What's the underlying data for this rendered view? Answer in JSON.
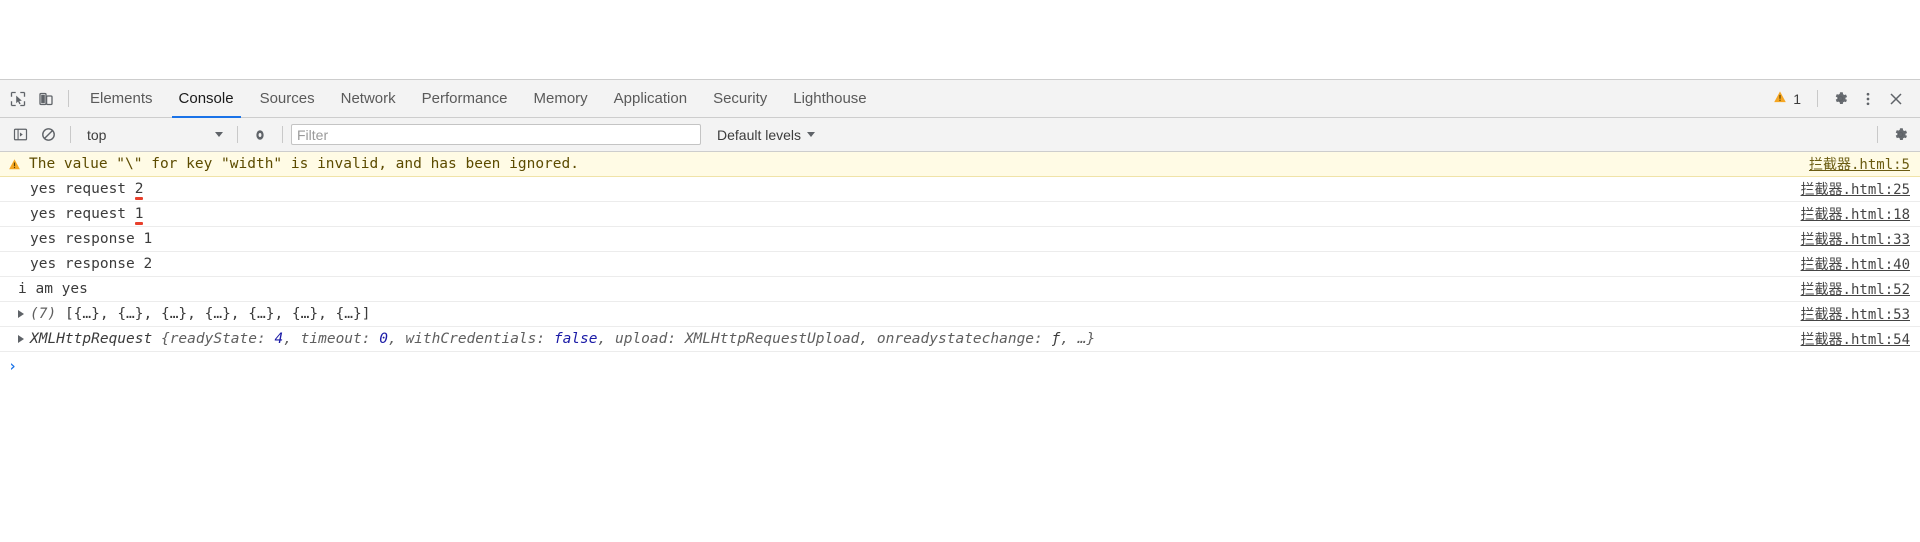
{
  "devtools": {
    "tabstrip": {
      "inspect_icon": "inspect-cursor-icon",
      "device_icon": "device-toolbar-icon",
      "tabs": [
        {
          "label": "Elements",
          "active": false
        },
        {
          "label": "Console",
          "active": true
        },
        {
          "label": "Sources",
          "active": false
        },
        {
          "label": "Network",
          "active": false
        },
        {
          "label": "Performance",
          "active": false
        },
        {
          "label": "Memory",
          "active": false
        },
        {
          "label": "Application",
          "active": false
        },
        {
          "label": "Security",
          "active": false
        },
        {
          "label": "Lighthouse",
          "active": false
        }
      ],
      "warning_count": "1",
      "warning_icon": "warning-triangle-icon",
      "settings_icon": "gear-icon",
      "more_icon": "kebab-menu-icon",
      "close_icon": "close-icon"
    },
    "filterbar": {
      "sidebar_icon": "console-sidebar-toggle-icon",
      "clear_icon": "clear-console-icon",
      "context": "top",
      "eye_icon": "live-expression-eye-icon",
      "filter_value": "",
      "filter_placeholder": "Filter",
      "levels": "Default levels",
      "settings_icon": "gear-icon"
    },
    "messages": [
      {
        "type": "warning",
        "icon": "warning-triangle-icon",
        "text": "The value \"\\\" for key \"width\" is invalid, and has been ignored.",
        "source": "拦截器.html:5"
      },
      {
        "type": "log",
        "text": "yes request ",
        "underlined": "2",
        "source": "拦截器.html:25"
      },
      {
        "type": "log",
        "text": "yes request ",
        "underlined": "1",
        "source": "拦截器.html:18"
      },
      {
        "type": "log",
        "text": "yes response 1",
        "source": "拦截器.html:33"
      },
      {
        "type": "log",
        "text": "yes response 2",
        "source": "拦截器.html:40"
      },
      {
        "type": "plain",
        "text": "i am yes",
        "source": "拦截器.html:52"
      },
      {
        "type": "array",
        "count": "(7)",
        "preview": "[{…}, {…}, {…}, {…}, {…}, {…}, {…}]",
        "source": "拦截器.html:53"
      },
      {
        "type": "object",
        "name": "XMLHttpRequest",
        "open_brace": "{",
        "props": [
          {
            "key": "readyState: ",
            "value": "4",
            "kind": "num",
            "sep": ", "
          },
          {
            "key": "timeout: ",
            "value": "0",
            "kind": "num",
            "sep": ", "
          },
          {
            "key": "withCredentials: ",
            "value": "false",
            "kind": "bool",
            "sep": ", "
          },
          {
            "key": "upload: ",
            "value": "XMLHttpRequestUpload",
            "kind": "plain",
            "sep": ", "
          },
          {
            "key": "onreadystatechange: ",
            "value": "ƒ",
            "kind": "fn",
            "sep": ", "
          },
          {
            "key": "",
            "value": "…",
            "kind": "plain",
            "sep": ""
          }
        ],
        "close_brace": "}",
        "source": "拦截器.html:54"
      }
    ],
    "prompt": {
      "chevron": "›",
      "value": "",
      "placeholder": ""
    }
  },
  "colors": {
    "accent": "#1a73e8",
    "warning_bg": "#fffbe5",
    "warning_text": "#5c4b00",
    "toolbar_bg": "#f3f3f3",
    "squiggle": "#e8402c",
    "value_blue": "#1a1aa6"
  }
}
